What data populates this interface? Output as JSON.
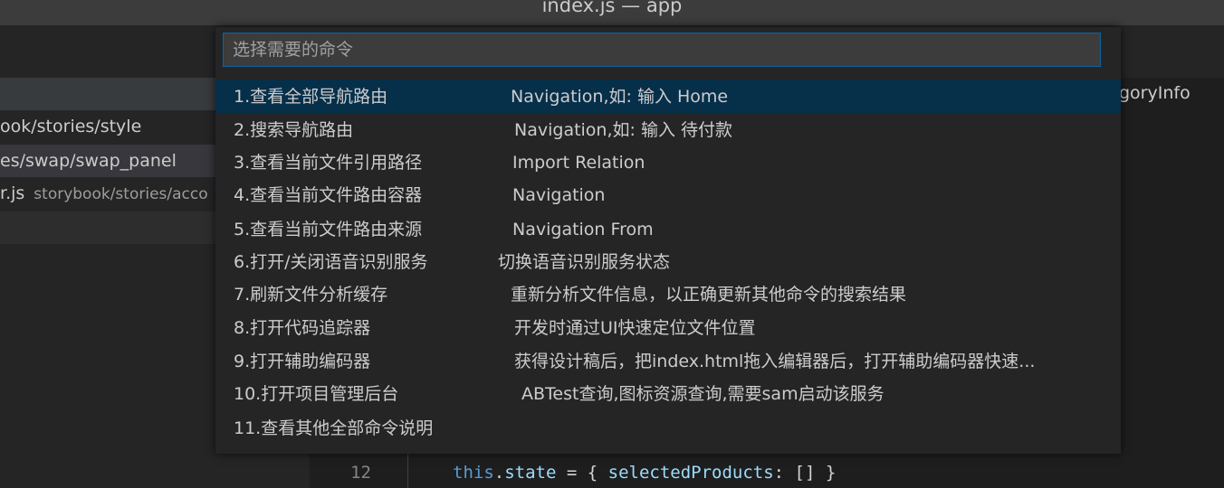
{
  "window": {
    "title": "index.js — app"
  },
  "sidebar": {
    "files": [
      {
        "label": "ook/stories/style",
        "desc": ""
      },
      {
        "label": "es/swap/swap_panel",
        "desc": ""
      },
      {
        "label": "r.js",
        "desc": "storybook/stories/acco"
      }
    ]
  },
  "editor": {
    "right_text": "goryInfo",
    "line_number": "12",
    "code": {
      "kw": "this",
      "p1": ".",
      "prop1": "state",
      "p2": " = { ",
      "prop2": "selectedProducts",
      "p3": ": [] }"
    }
  },
  "palette": {
    "placeholder": "选择需要的命令",
    "items": [
      {
        "label": "1.查看全部导航路由",
        "detail": "Navigation,如: 输入 Home"
      },
      {
        "label": "2.搜索导航路由",
        "detail": "Navigation,如: 输入 待付款"
      },
      {
        "label": "3.查看当前文件引用路径",
        "detail": "Import Relation"
      },
      {
        "label": "4.查看当前文件路由容器",
        "detail": "Navigation"
      },
      {
        "label": "5.查看当前文件路由来源",
        "detail": "Navigation From"
      },
      {
        "label": "6.打开/关闭语音识别服务",
        "detail": "切换语音识别服务状态"
      },
      {
        "label": "7.刷新文件分析缓存",
        "detail": "重新分析文件信息，以正确更新其他命令的搜索结果"
      },
      {
        "label": "8.打开代码追踪器",
        "detail": "开发时通过UI快速定位文件位置"
      },
      {
        "label": "9.打开辅助编码器",
        "detail": "获得设计稿后，把index.html拖入编辑器后，打开辅助编码器快速..."
      },
      {
        "label": "10.打开项目管理后台",
        "detail": "ABTest查询,图标资源查询,需要sam启动该服务"
      },
      {
        "label": "11.查看其他全部命令说明",
        "detail": ""
      }
    ]
  }
}
